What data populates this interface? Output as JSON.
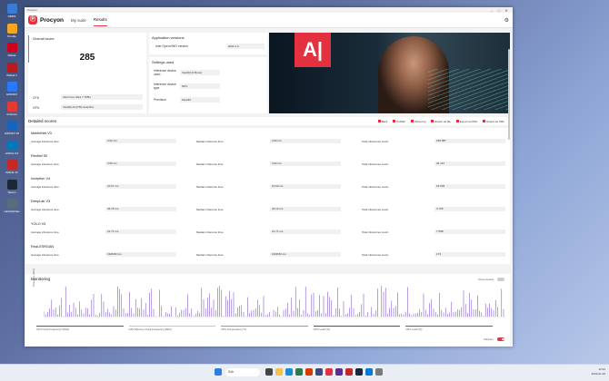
{
  "desktop": {
    "icons": [
      {
        "label": "DBMS",
        "color": "#3a7bd5"
      },
      {
        "label": "Rondle",
        "color": "#f5a623"
      },
      {
        "label": "Wiktak",
        "color": "#d0021b"
      },
      {
        "label": "Wiktak 1",
        "color": "#b71c1c"
      },
      {
        "label": "HWiNFO",
        "color": "#2979ff"
      },
      {
        "label": "Antivirus",
        "color": "#e53935"
      },
      {
        "label": "HWiNFO 32",
        "color": "#1565c0"
      },
      {
        "label": "HWinfo 64",
        "color": "#0277bd"
      },
      {
        "label": "Wiktak 1K",
        "color": "#c62828"
      },
      {
        "label": "Steam",
        "color": "#1b2838"
      },
      {
        "label": "HashMyFiles",
        "color": "#546e7a"
      }
    ]
  },
  "window": {
    "titlebar": {
      "title": "Procyon",
      "min": "–",
      "max": "□",
      "close": "✕"
    },
    "brand": "Procyon",
    "nav": [
      {
        "label": "My suite"
      },
      {
        "label": "Results"
      }
    ],
    "settings_icon": "gear-icon"
  },
  "overview": {
    "overall_label": "Overall score",
    "score": "285",
    "cpu_label": "CPU",
    "cpu_value": "Intel Core Ultra 7 155H",
    "gpu_label": "GPU",
    "gpu_value": "Intel(R) Arc(TM) Graphics",
    "app_versions_title": "Application versions",
    "app_versions": [
      {
        "name": "Intel OpenVINO version",
        "value": "2023.1.0"
      }
    ],
    "settings_title": "Settings used",
    "settings": [
      {
        "name": "Inference device used",
        "value": "Intel(R) AI Boost"
      },
      {
        "name": "Inference device type",
        "value": "NPU"
      },
      {
        "name": "Precision",
        "value": "Float32"
      }
    ]
  },
  "detailed": {
    "title": "Detailed scores",
    "actions": [
      {
        "label": "Back",
        "icon": "back-icon"
      },
      {
        "label": "Publish",
        "icon": "publish-icon"
      },
      {
        "label": "Show log",
        "icon": "log-icon"
      },
      {
        "label": "Export as file",
        "icon": "export-file-icon"
      },
      {
        "label": "Export as PDF",
        "icon": "pdf-icon"
      },
      {
        "label": "Export as XML",
        "icon": "xml-icon"
      }
    ],
    "col_avg": "Average inference time",
    "col_med": "Median inference time",
    "col_cnt": "Total inferences count",
    "benchmarks": [
      {
        "name": "MobileNet V3",
        "avg": "0.92 ms",
        "med": "0.90 ms",
        "count": "155 687"
      },
      {
        "name": "ResNet 50",
        "avg": "3.05 ms",
        "med": "3.02 ms",
        "count": "34 427"
      },
      {
        "name": "Inception V4",
        "avg": "10.67 ms",
        "med": "10.64 ms",
        "count": "15 029"
      },
      {
        "name": "DeepLab V3",
        "avg": "44.15 ms",
        "med": "44.13 ms",
        "count": "3 735"
      },
      {
        "name": "YOLO V3",
        "avg": "21.71 ms",
        "med": "21.71 ms",
        "count": "7 598"
      },
      {
        "name": "Real-ESRGAN",
        "avg": "1928.82 ms",
        "med": "1928.82 ms",
        "count": "173"
      }
    ]
  },
  "monitoring": {
    "title": "Monitoring",
    "show_details_label": "Show details",
    "markers_label": "Markers",
    "y_label": "Frequency (MHz)",
    "legend": [
      {
        "label": "CPU Clock Frequency (MHz)",
        "color": "#6a3fc4"
      },
      {
        "label": "GPU Memory Clock Frequency (MHz)",
        "color": "#f5c542"
      },
      {
        "label": "CPU Temperature (°C)",
        "color": "#46c1a5"
      },
      {
        "label": "GPU Load (%)",
        "color": "#d0192b"
      },
      {
        "label": "CPU Load (%)",
        "color": "#3c5fd6"
      }
    ]
  },
  "taskbar": {
    "search_placeholder": "Sök",
    "time": "12:34",
    "date": "2024-01-25"
  }
}
